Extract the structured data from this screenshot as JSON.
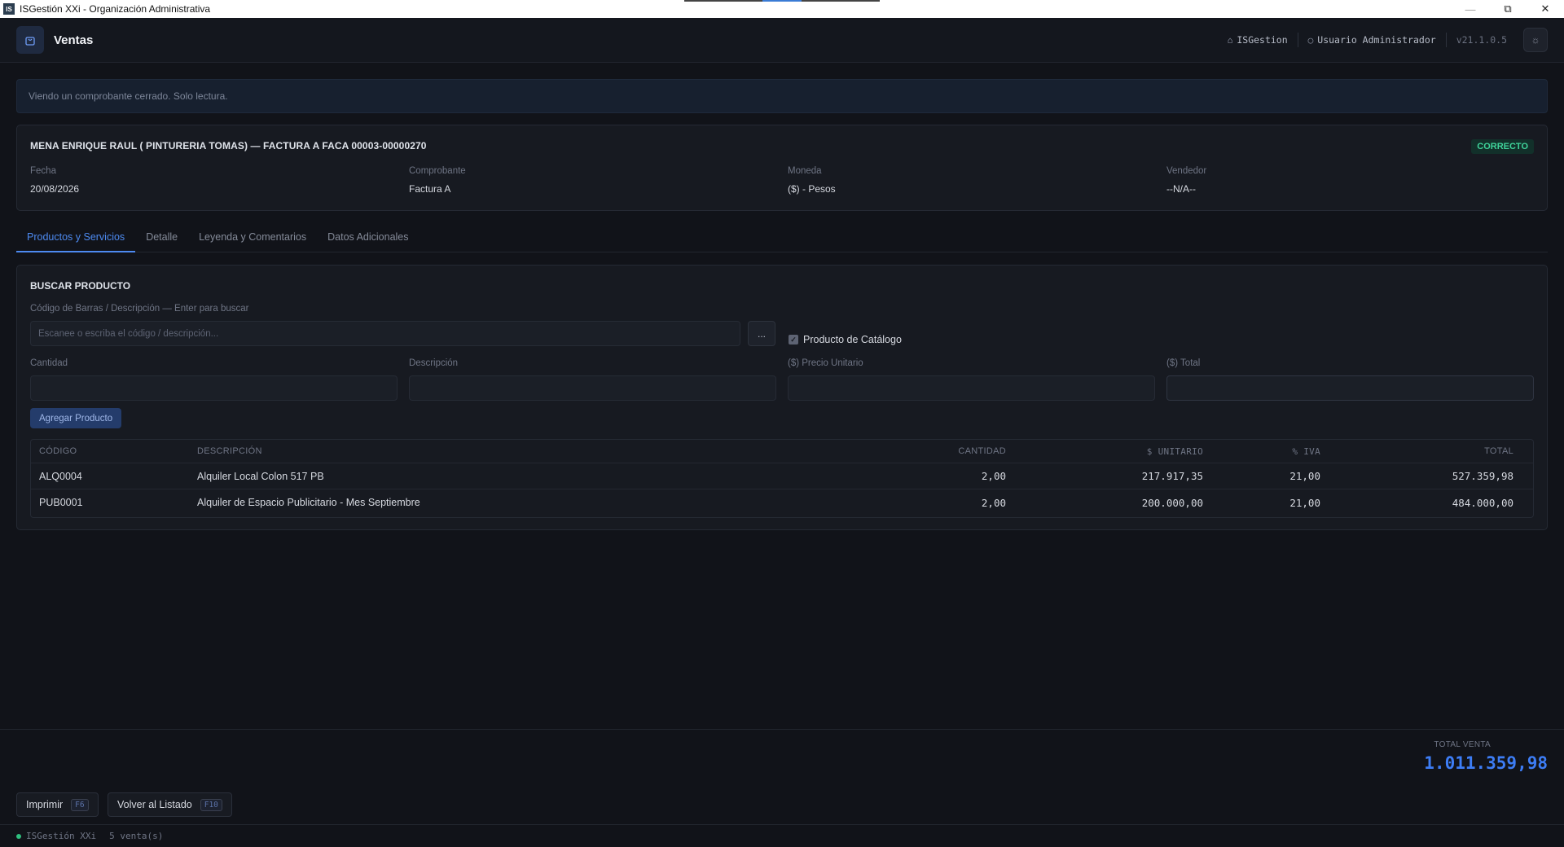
{
  "window": {
    "title": "ISGestión XXi - Organización Administrativa",
    "icon_text": "IS"
  },
  "header": {
    "title": "Ventas",
    "company": "ISGestion",
    "user": "Usuario Administrador",
    "version": "v21.1.0.5"
  },
  "notice": "Viendo un comprobante cerrado. Solo lectura.",
  "summary": {
    "title": "MENA ENRIQUE RAUL ( PINTURERIA TOMAS) — FACTURA A FACA 00003-00000270",
    "status": "CORRECTO",
    "fields": [
      {
        "label": "Fecha",
        "value": "20/08/2026"
      },
      {
        "label": "Comprobante",
        "value": "Factura A"
      },
      {
        "label": "Moneda",
        "value": "($) - Pesos"
      },
      {
        "label": "Vendedor",
        "value": "--N/A--"
      }
    ]
  },
  "tabs": [
    {
      "label": "Productos y Servicios"
    },
    {
      "label": "Detalle"
    },
    {
      "label": "Leyenda y Comentarios"
    },
    {
      "label": "Datos Adicionales"
    }
  ],
  "search": {
    "title": "BUSCAR PRODUCTO",
    "barcode_label": "Código de Barras / Descripción — Enter para buscar",
    "barcode_placeholder": "Escanee o escriba el código / descripción...",
    "dots_label": "...",
    "catalog_label": "Producto de Catálogo",
    "catalog_checked": true,
    "qty_label": "Cantidad",
    "desc_label": "Descripción",
    "price_label": "($) Precio Unitario",
    "total_label": "($) Total",
    "add_label": "Agregar Producto"
  },
  "table": {
    "headers": {
      "code": "CÓDIGO",
      "desc": "DESCRIPCIÓN",
      "qty": "CANTIDAD",
      "unit": "$ UNITARIO",
      "iva": "% IVA",
      "total": "TOTAL"
    },
    "rows": [
      {
        "code": "ALQ0004",
        "desc": "Alquiler Local Colon 517 PB",
        "qty": "2,00",
        "unit": "217.917,35",
        "iva": "21,00",
        "total": "527.359,98"
      },
      {
        "code": "PUB0001",
        "desc": "Alquiler de Espacio Publicitario - Mes Septiembre",
        "qty": "2,00",
        "unit": "200.000,00",
        "iva": "21,00",
        "total": "484.000,00"
      }
    ]
  },
  "footer": {
    "total_label": "TOTAL VENTA",
    "total_value": "1.011.359,98",
    "print_label": "Imprimir",
    "print_key": "F6",
    "back_label": "Volver al Listado",
    "back_key": "F10"
  },
  "status": {
    "app": "ISGestión XXi",
    "count": "5 venta(s)"
  },
  "colors": {
    "accent": "#4d8af0",
    "success": "#3fd39a",
    "background": "#111319"
  }
}
